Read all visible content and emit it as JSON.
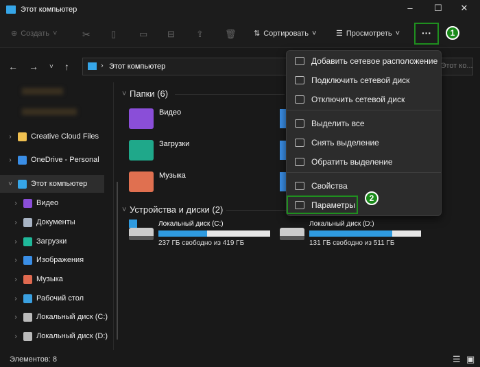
{
  "window": {
    "title": "Этот компьютер",
    "minimize": "–",
    "maximize": "☐",
    "close": "✕"
  },
  "toolbar": {
    "create": "Создать",
    "sort": "Сортировать",
    "view": "Просмотреть",
    "more": "···"
  },
  "address": {
    "path": "Этот компьютер",
    "search_placeholder": "Поиск: Этот ко..."
  },
  "sidebar": {
    "items": [
      {
        "label": "Creative Cloud Files",
        "icon": "creative-cloud-icon",
        "color": "#f0c050"
      },
      {
        "label": "OneDrive - Personal",
        "icon": "cloud-icon",
        "color": "#3a8ee6"
      },
      {
        "label": "Этот компьютер",
        "icon": "computer-icon",
        "color": "#36a6e8"
      },
      {
        "label": "Видео",
        "icon": "video-icon",
        "color": "#8a4ed8"
      },
      {
        "label": "Документы",
        "icon": "document-icon",
        "color": "#a8b4c4"
      },
      {
        "label": "Загрузки",
        "icon": "download-icon",
        "color": "#1fb89a"
      },
      {
        "label": "Изображения",
        "icon": "image-icon",
        "color": "#3a8ee6"
      },
      {
        "label": "Музыка",
        "icon": "music-icon",
        "color": "#e06a50"
      },
      {
        "label": "Рабочий стол",
        "icon": "desktop-icon",
        "color": "#3aa0e0"
      },
      {
        "label": "Локальный диск (C:)",
        "icon": "drive-icon",
        "color": "#bbbbbb"
      },
      {
        "label": "Локальный диск (D:)",
        "icon": "drive-icon",
        "color": "#bbbbbb"
      }
    ]
  },
  "content": {
    "folders_header": "Папки (6)",
    "folders": [
      {
        "label": "Видео",
        "color": "#8a4ed8"
      },
      {
        "label": "Загрузки",
        "color": "#1fa88a"
      },
      {
        "label": "Музыка",
        "color": "#e07050"
      }
    ],
    "drives_header": "Устройства и диски (2)",
    "drives": [
      {
        "name": "Локальный диск (C:)",
        "info": "237 ГБ свободно из 419 ГБ",
        "used_fraction": 0.434
      },
      {
        "name": "Локальный диск (D:)",
        "info": "131 ГБ свободно из 511 ГБ",
        "used_fraction": 0.744
      }
    ]
  },
  "menu": {
    "items": [
      "Добавить сетевое расположение",
      "Подключить сетевой диск",
      "Отключить сетевой диск",
      "Выделить все",
      "Снять выделение",
      "Обратить выделение",
      "Свойства",
      "Параметры"
    ]
  },
  "badges": [
    "1",
    "2"
  ],
  "status": {
    "count": "Элементов: 8"
  }
}
